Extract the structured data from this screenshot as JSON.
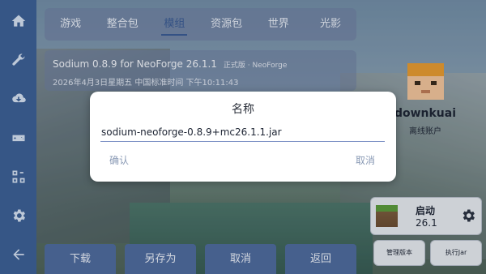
{
  "tabs": [
    "游戏",
    "整合包",
    "模组",
    "资源包",
    "世界",
    "光影"
  ],
  "active_tab": "模组",
  "mod": {
    "title": "Sodium 0.8.9 for NeoForge 26.1.1",
    "tag": "正式版 · NeoForge",
    "date": "2026年4月3日星期五 中国标准时间 下午10:11:43"
  },
  "bottom_buttons": [
    "下载",
    "另存为",
    "取消",
    "返回"
  ],
  "user": {
    "name": "downkuai",
    "account_type": "离线账户"
  },
  "launch": {
    "label": "启动",
    "version": "26.1"
  },
  "small_buttons": [
    "管理版本",
    "执行Jar"
  ],
  "dialog": {
    "title": "名称",
    "input_value": "sodium-neoforge-0.8.9+mc26.1.1.jar",
    "confirm": "确认",
    "cancel": "取消"
  },
  "sidebar": {
    "icons": [
      "home-icon",
      "wrench-icon",
      "cloud-download-icon",
      "gamepad-icon",
      "blocks-icon",
      "gear-icon",
      "back-arrow-icon"
    ]
  },
  "colors": {
    "sidebar": "#3c5f94",
    "accent": "#3a5a93",
    "dialog_underline": "#7a8fc4"
  }
}
